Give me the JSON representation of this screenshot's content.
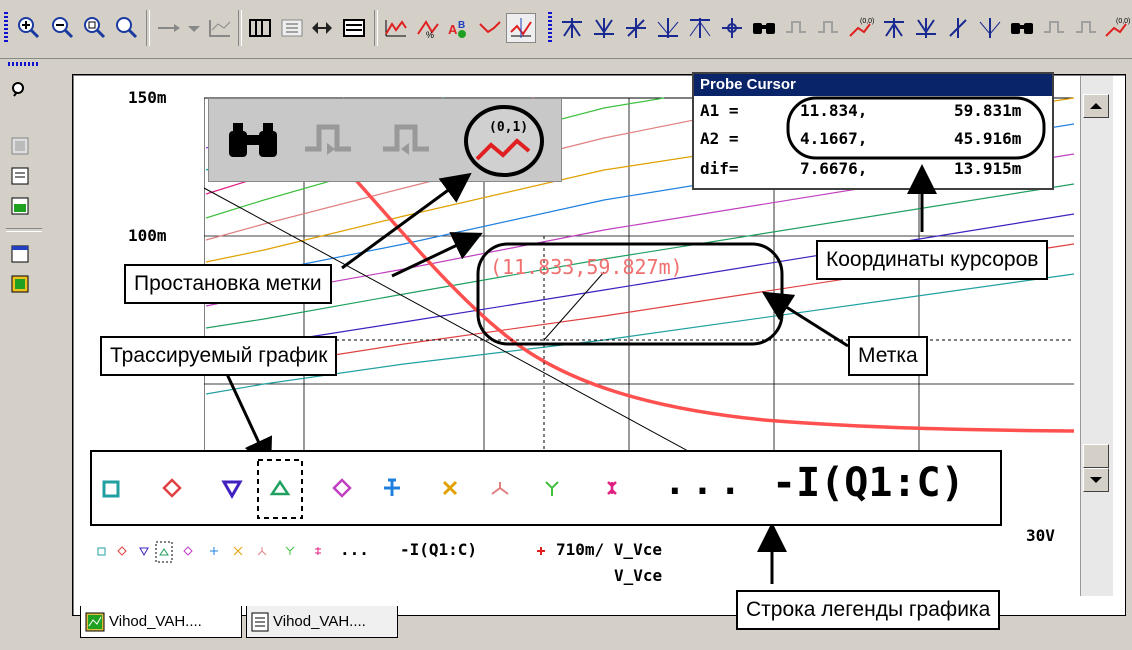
{
  "toolbar": {
    "buttons": [
      "zoom-in-icon",
      "zoom-out-icon",
      "zoom-area-icon",
      "zoom-fit-icon",
      "arrow-right-icon",
      "arrow-down-icon",
      "axis-settings-icon",
      "grid-icon",
      "text-label-icon",
      "toggle-cursor-icon",
      "legend-icon",
      "add-trace-icon",
      "fourier-icon",
      "performance-icon",
      "mark-label-icon",
      "toggle-cursor-active-icon",
      "cursor-peak-icon",
      "cursor-trough-icon",
      "cursor-slope-icon",
      "cursor-min-icon",
      "cursor-max-icon",
      "cursor-point-icon",
      "cursor-search-icon",
      "cursor-next-transition-icon",
      "cursor-prev-transition-icon",
      "mark-label-small-icon"
    ]
  },
  "left_toolbar": {
    "buttons": [
      "probe-icon",
      "simulate-icon",
      "edit-icon",
      "settings-icon",
      "output-file-icon",
      "report-icon"
    ]
  },
  "plot": {
    "y_top_label": "150m",
    "y_mid_label": "100m",
    "x_right_label": "30V",
    "mark_text": "(11.833,59.827m)"
  },
  "probe_cursor": {
    "title": "Probe Cursor",
    "rows": [
      {
        "label": "A1 =",
        "x": "11.834,",
        "y": "59.831m"
      },
      {
        "label": "A2 =",
        "x": "4.1667,",
        "y": "45.916m"
      },
      {
        "label": "dif=",
        "x": "7.6676,",
        "y": "13.915m"
      }
    ]
  },
  "callouts": {
    "mark_placement": "Простановка метки",
    "traced_graph": "Трассируемый график",
    "cursor_coords": "Координаты курсоров",
    "mark": "Метка",
    "legend_row": "Строка легенды графика"
  },
  "legend": {
    "ellipsis": "...",
    "trace_name": "-I(Q1:C)",
    "small_ellipsis": "...",
    "small_trace_name": "-I(Q1:C)",
    "small_extra": "710m/ V_Vce",
    "x_axis_label": "V_Vce"
  },
  "tabs": [
    {
      "label": "Vihod_VAH...."
    },
    {
      "label": "Vihod_VAH...."
    }
  ],
  "colors": {
    "title_bar": "#0a246a",
    "load_line": "#ff5050",
    "marker_red": "#e03030"
  }
}
